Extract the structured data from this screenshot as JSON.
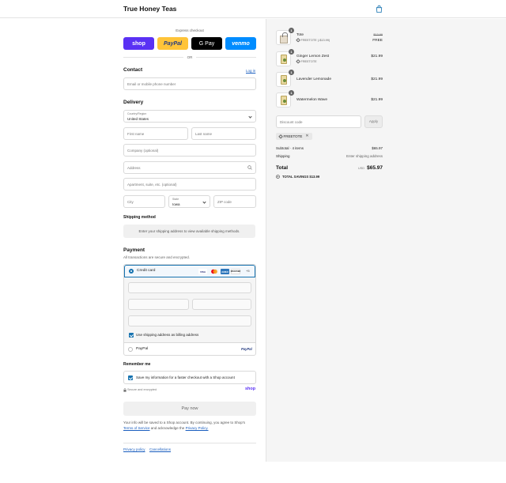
{
  "header": {
    "brand": "True Honey Teas",
    "cart_icon": "shopping-bag-icon"
  },
  "express": {
    "title": "Express checkout",
    "buttons": [
      {
        "label": "shop",
        "color": "#5a31f4"
      },
      {
        "label": "PayPal",
        "color": "#ffc439"
      },
      {
        "label": "G Pay",
        "color": "#000000"
      },
      {
        "label": "venmo",
        "color": "#008cff"
      }
    ],
    "or": "OR"
  },
  "contact": {
    "title": "Contact",
    "login": "Log in",
    "placeholder": "Email or mobile phone number"
  },
  "delivery": {
    "title": "Delivery",
    "country_label": "Country/Region",
    "country_value": "United States",
    "first_name": "First name",
    "last_name": "Last name",
    "company": "Company (optional)",
    "address": "Address",
    "apartment": "Apartment, suite, etc. (optional)",
    "city": "City",
    "state_label": "State",
    "state_value": "Iowa",
    "zip": "ZIP code"
  },
  "shipping": {
    "title": "Shipping method",
    "message": "Enter your shipping address to view available shipping methods."
  },
  "payment": {
    "title": "Payment",
    "subtitle": "All transactions are secure and encrypted.",
    "credit_card": "Credit card",
    "card_brands": [
      "VISA",
      "MC",
      "AMEX",
      "DISCOVER"
    ],
    "more_cards": "+5",
    "billing_same": "Use shipping address as billing address",
    "paypal": "PayPal",
    "paypal_logo": "PayPal"
  },
  "remember": {
    "title": "Remember me",
    "save_info": "Save my information for a faster checkout with a Shop account",
    "secure": "Secure and encrypted",
    "shop_logo": "shop"
  },
  "pay_now": "Pay now",
  "legal": {
    "line1": "Your info will be saved to a Shop account. By continuing, you agree to Shop's",
    "terms": "Terms of Service",
    "and": "and acknowledge the",
    "privacy": "Privacy Policy."
  },
  "footer": {
    "privacy": "Privacy policy",
    "cancellations": "Cancellations"
  },
  "cart": {
    "items": [
      {
        "qty": "1",
        "name": "Tote",
        "sub": "FREETOTE (-$13.99)",
        "old_price": "$13.99",
        "price": "FREE"
      },
      {
        "qty": "1",
        "name": "Ginger Lemon Zest",
        "sub": "FREETOTE",
        "price": "$21.99"
      },
      {
        "qty": "1",
        "name": "Lavender Lemonade",
        "price": "$21.99"
      },
      {
        "qty": "1",
        "name": "Watermelon Wave",
        "price": "$21.99"
      }
    ],
    "discount_placeholder": "Discount code",
    "apply": "Apply",
    "applied_code": "FREETOTE",
    "subtotal_label": "Subtotal · 4 items",
    "subtotal": "$65.97",
    "shipping_label": "Shipping",
    "shipping_value": "Enter shipping address",
    "total_label": "Total",
    "currency": "USD",
    "total": "$65.97",
    "savings_label": "TOTAL SAVINGS",
    "savings": "$13.99"
  }
}
